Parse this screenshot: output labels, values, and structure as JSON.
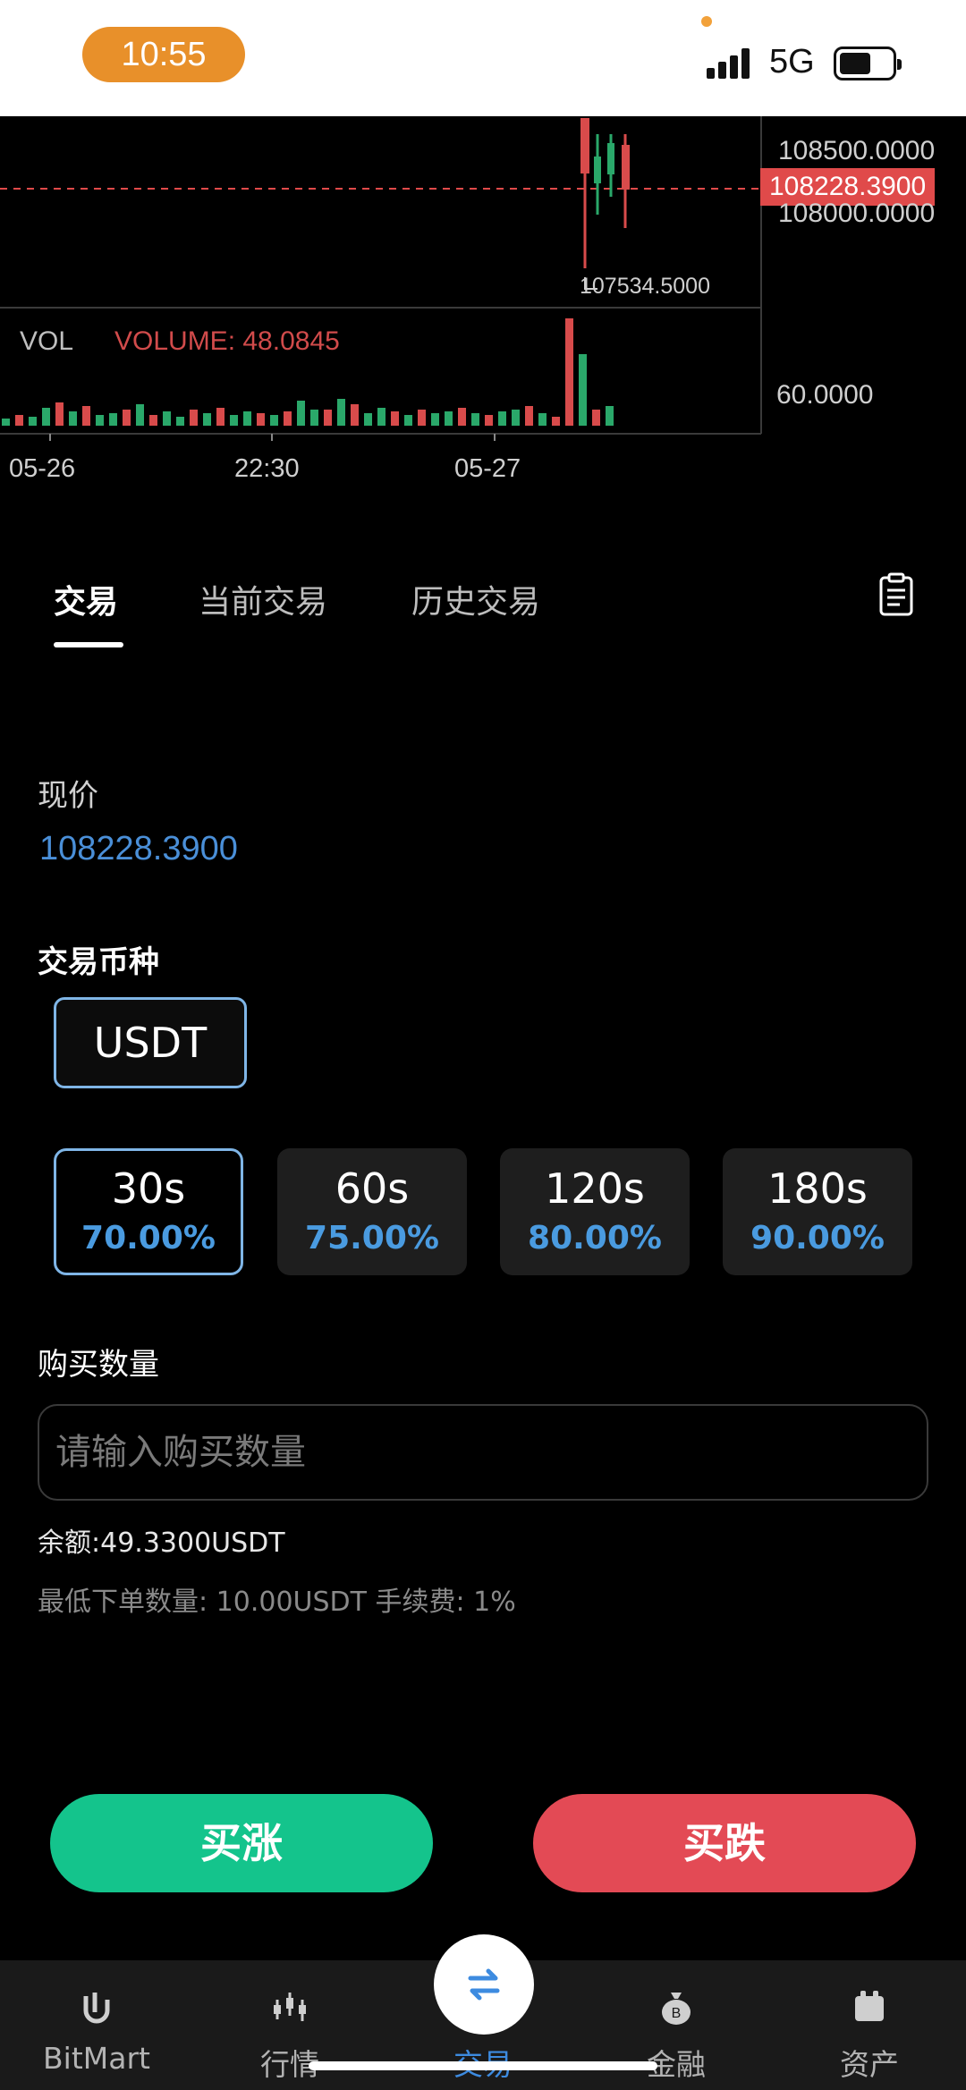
{
  "status_bar": {
    "time": "10:55",
    "network": "5G"
  },
  "chart": {
    "price_levels": {
      "upper": "108500.0000",
      "lower": "108000.0000",
      "current": "108228.3900"
    },
    "low_marker": "107534.5000",
    "volume": {
      "indicator": "VOL",
      "label": "VOLUME: 48.0845",
      "axis": "60.0000"
    },
    "time_labels": [
      "05-26",
      "22:30",
      "05-27"
    ],
    "colors": {
      "up": "#2aa86a",
      "down": "#d84b4b"
    }
  },
  "tabs": [
    {
      "label": "交易",
      "active": true
    },
    {
      "label": "当前交易",
      "active": false
    },
    {
      "label": "历史交易",
      "active": false
    }
  ],
  "trade": {
    "current_price_label": "现价",
    "current_price": "108228.3900",
    "coin_label": "交易币种",
    "coin": "USDT",
    "periods": [
      {
        "time": "30s",
        "rate": "70.00%",
        "selected": true
      },
      {
        "time": "60s",
        "rate": "75.00%",
        "selected": false
      },
      {
        "time": "120s",
        "rate": "80.00%",
        "selected": false
      },
      {
        "time": "180s",
        "rate": "90.00%",
        "selected": false
      }
    ],
    "amount_label": "购买数量",
    "amount_placeholder": "请输入购买数量",
    "balance": "余额:49.3300USDT",
    "min_info": "最低下单数量: 10.00USDT   手续费: 1%",
    "buy_up": "买涨",
    "buy_down": "买跌"
  },
  "bottom_nav": [
    {
      "label": "BitMart",
      "icon": "bitmart-logo-icon"
    },
    {
      "label": "行情",
      "icon": "market-icon"
    },
    {
      "label": "交易",
      "icon": "swap-icon",
      "active": true
    },
    {
      "label": "金融",
      "icon": "money-bag-icon"
    },
    {
      "label": "资产",
      "icon": "wallet-icon"
    }
  ],
  "accent_colors": {
    "blue": "#4a8fd8",
    "green": "#14c48c",
    "red": "#e34a55"
  }
}
